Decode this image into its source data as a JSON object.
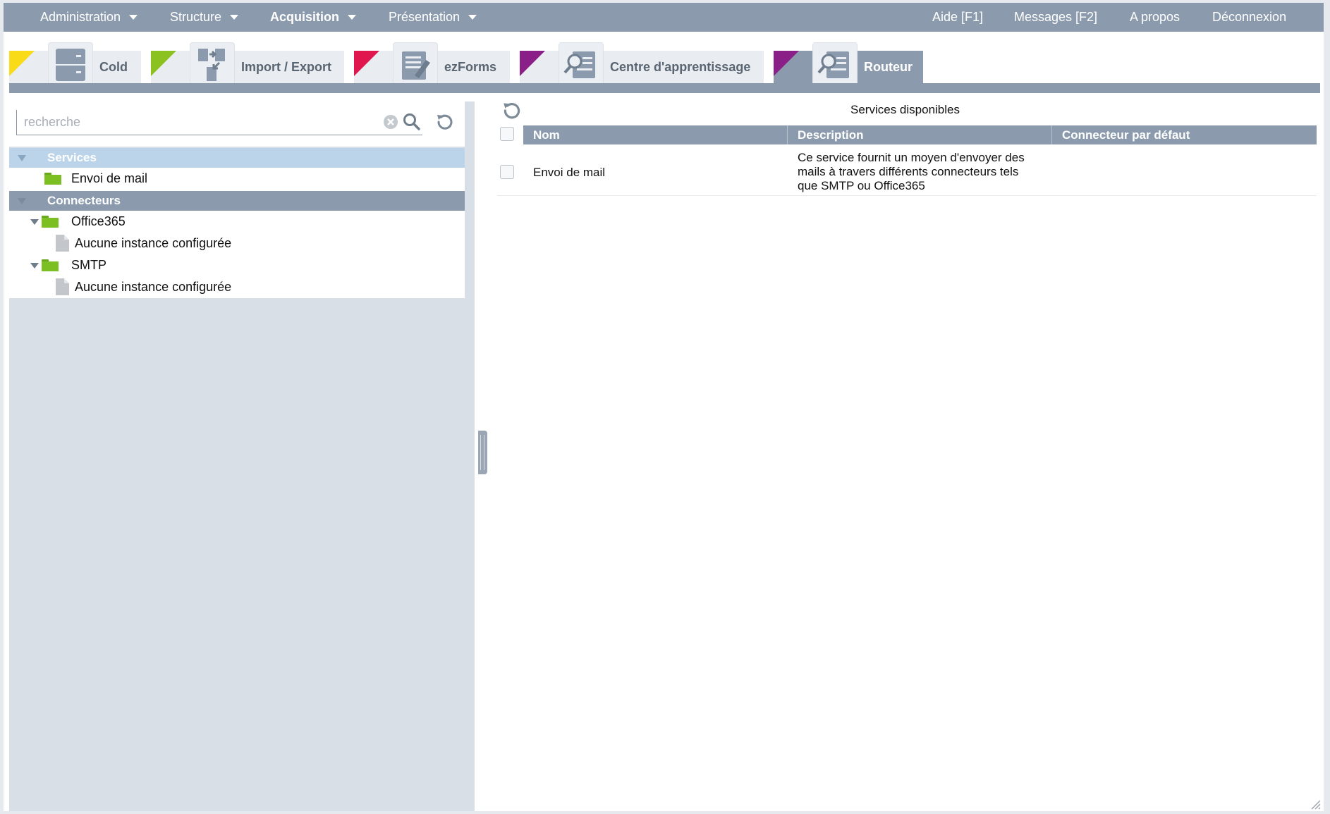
{
  "menu": {
    "left": [
      {
        "label": "Administration",
        "bold": false,
        "dropdown": true
      },
      {
        "label": "Structure",
        "bold": false,
        "dropdown": true
      },
      {
        "label": "Acquisition",
        "bold": true,
        "dropdown": true
      },
      {
        "label": "Présentation",
        "bold": false,
        "dropdown": true
      }
    ],
    "right": [
      {
        "label": "Aide [F1]"
      },
      {
        "label": "Messages [F2]"
      },
      {
        "label": "A propos"
      },
      {
        "label": "Déconnexion"
      }
    ]
  },
  "tabs": [
    {
      "label": "Cold",
      "flag_color": "#f9dc17",
      "icon": "cabinet-icon",
      "active": false
    },
    {
      "label": "Import / Export",
      "flag_color": "#8cc21f",
      "icon": "import-export-icon",
      "active": false
    },
    {
      "label": "ezForms",
      "flag_color": "#e0174f",
      "icon": "form-edit-icon",
      "active": false
    },
    {
      "label": "Centre d'apprentissage",
      "flag_color": "#8a1f87",
      "icon": "document-search-icon",
      "active": false
    },
    {
      "label": "Routeur",
      "flag_color": "#8a1f87",
      "icon": "document-search-icon",
      "active": true
    }
  ],
  "search": {
    "placeholder": "recherche",
    "value": ""
  },
  "tree": {
    "services_header": "Services",
    "services": [
      {
        "label": "Envoi de mail"
      }
    ],
    "connectors_header": "Connecteurs",
    "connectors": [
      {
        "label": "Office365",
        "children": [
          "Aucune instance configurée"
        ]
      },
      {
        "label": "SMTP",
        "children": [
          "Aucune instance configurée"
        ]
      }
    ]
  },
  "grid": {
    "title": "Services disponibles",
    "columns": [
      "Nom",
      "Description",
      "Connecteur par défaut"
    ],
    "rows": [
      {
        "nom": "Envoi de mail",
        "description_lines": [
          "Ce service fournit un moyen d'envoyer des",
          "mails à travers différents connecteurs tels",
          "que SMTP ou Office365"
        ],
        "connecteur": ""
      }
    ]
  },
  "colors": {
    "menu_bar": "#8b9bad",
    "panel_bg": "#d8dfe6",
    "tree_selected": "#bcd4ea",
    "folder_green": "#7cbf22"
  }
}
